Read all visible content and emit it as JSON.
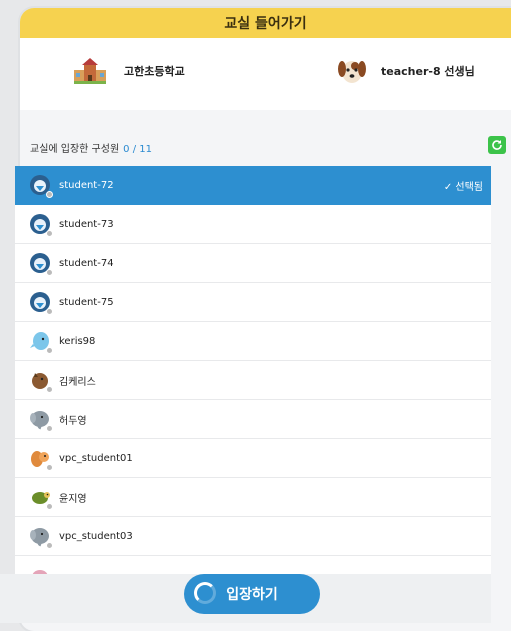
{
  "header": {
    "title": "교실 들어가기"
  },
  "info": {
    "school_name": "고한초등학교",
    "teacher_name": "teacher-8 선생님"
  },
  "members": {
    "label": "교실에 입장한 구성원",
    "count": "0 / 11"
  },
  "list": {
    "selected_badge": "✓ 선택됨",
    "items": [
      {
        "name": "student-72",
        "icon": "student-avatar-icon"
      },
      {
        "name": "student-73",
        "icon": "student-avatar-icon"
      },
      {
        "name": "student-74",
        "icon": "student-avatar-icon"
      },
      {
        "name": "student-75",
        "icon": "student-avatar-icon"
      },
      {
        "name": "keris98",
        "icon": "dolphin-avatar-icon"
      },
      {
        "name": "김케리스",
        "icon": "horse-avatar-icon"
      },
      {
        "name": "허두영",
        "icon": "elephant-avatar-icon"
      },
      {
        "name": "vpc_student01",
        "icon": "squirrel-avatar-icon"
      },
      {
        "name": "윤지영",
        "icon": "turtle-avatar-icon"
      },
      {
        "name": "vpc_student03",
        "icon": "elephant-avatar-icon"
      }
    ]
  },
  "footer": {
    "enter_label": "입장하기"
  },
  "colors": {
    "accent": "#2d8fd0",
    "header": "#f6d24f",
    "refresh": "#3cc34a"
  }
}
